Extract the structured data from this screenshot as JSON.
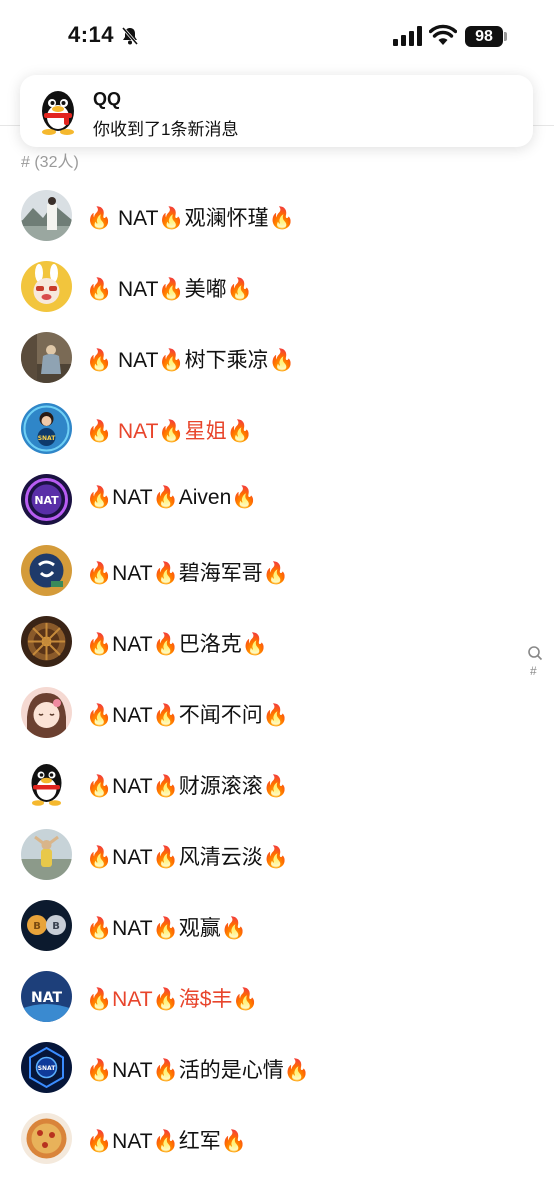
{
  "status_bar": {
    "time": "4:14",
    "battery": "98"
  },
  "notification": {
    "title": "QQ",
    "body": "你收到了1条新消息"
  },
  "member_count": "# (32人)",
  "members": [
    {
      "name": "🔥 NAT🔥观澜怀瑾🔥",
      "color": "#111111",
      "avatar": "landscape-person-avatar"
    },
    {
      "name": "🔥 NAT🔥美嘟🔥",
      "color": "#111111",
      "avatar": "rabbit-cartoon-avatar"
    },
    {
      "name": "🔥 NAT🔥树下乘凉🔥",
      "color": "#111111",
      "avatar": "monk-figure-avatar"
    },
    {
      "name": "🔥 NAT🔥星姐🔥",
      "color": "#e8452c",
      "avatar": "snat-woman-avatar"
    },
    {
      "name": "🔥NAT🔥Aiven🔥",
      "color": "#111111",
      "avatar": "nat-neon-logo-avatar"
    },
    {
      "name": "🔥NAT🔥碧海军哥🔥",
      "color": "#111111",
      "avatar": "calligraphy-badge-avatar"
    },
    {
      "name": "🔥NAT🔥巴洛克🔥",
      "color": "#111111",
      "avatar": "golden-wheel-avatar"
    },
    {
      "name": "🔥NAT🔥不闻不问🔥",
      "color": "#111111",
      "avatar": "cartoon-girl-avatar"
    },
    {
      "name": "🔥NAT🔥财源滚滚🔥",
      "color": "#111111",
      "avatar": "qq-penguin-avatar"
    },
    {
      "name": "🔥NAT🔥风清云淡🔥",
      "color": "#111111",
      "avatar": "beach-person-avatar"
    },
    {
      "name": "🔥NAT🔥观赢🔥",
      "color": "#111111",
      "avatar": "bitcoin-coins-avatar"
    },
    {
      "name": "🔥NAT🔥海$丰🔥",
      "color": "#e8452c",
      "avatar": "nat-logo-avatar"
    },
    {
      "name": "🔥NAT🔥活的是心情🔥",
      "color": "#111111",
      "avatar": "snat-hexagon-avatar"
    },
    {
      "name": "🔥NAT🔥红军🔥",
      "color": "#111111",
      "avatar": "pizza-badge-avatar"
    }
  ],
  "index_bar": {
    "hash": "#"
  },
  "colors": {
    "highlight_name": "#e8452c",
    "secondary_text": "#9a9a9a"
  }
}
